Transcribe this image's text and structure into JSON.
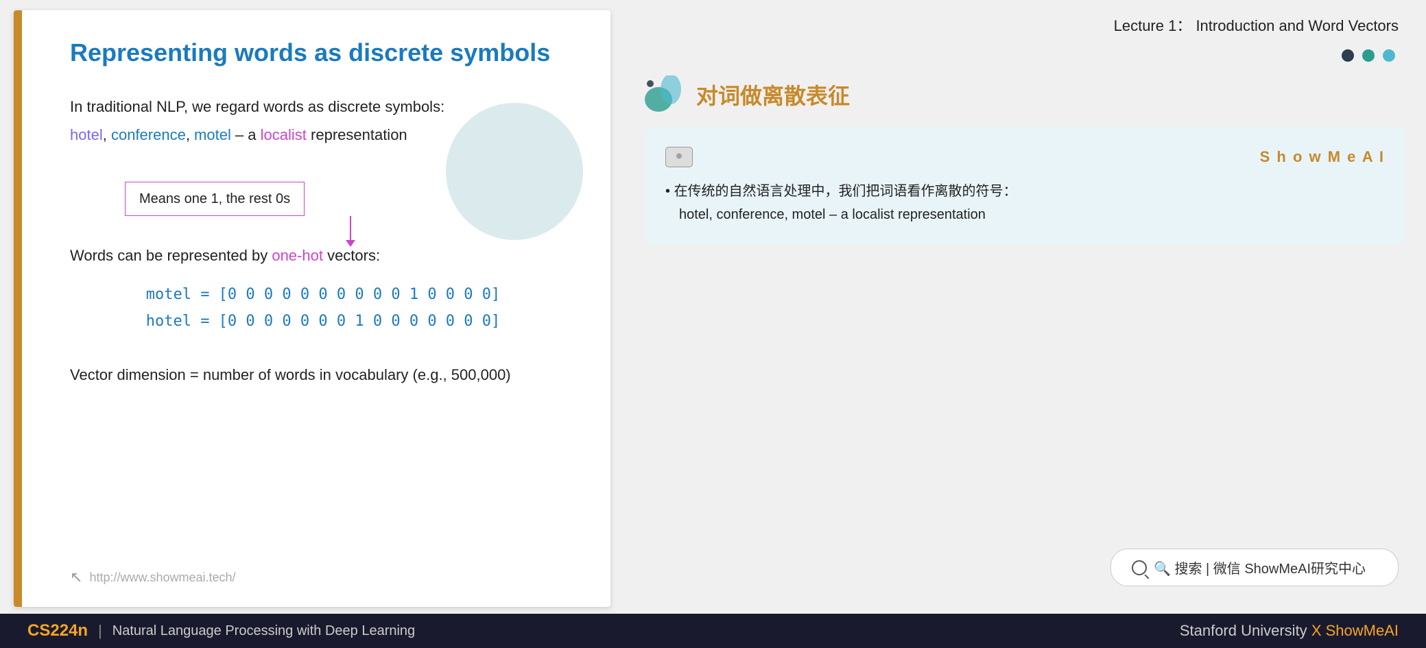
{
  "lecture": {
    "title": "Lecture 1： Introduction and Word Vectors"
  },
  "slide": {
    "title": "Representing words as discrete symbols",
    "paragraph1": "In traditional NLP, we regard words as discrete symbols:",
    "words_colored": "hotel, conference, motel",
    "rest_of_line": " – a ",
    "localist": "localist",
    "representation": " representation",
    "callout_text": "Means one 1, the rest 0s",
    "one_hot_intro": "Words can be represented by ",
    "one_hot": "one-hot",
    "one_hot_end": " vectors:",
    "vector1": "motel = [0 0 0 0 0 0 0 0 0 0 1 0 0 0 0]",
    "vector2": "hotel = [0 0 0 0 0 0 0 1 0 0 0 0 0 0 0]",
    "vocab_note": "Vector dimension = number of words in vocabulary (e.g., 500,000)",
    "footer_url": "http://www.showmeai.tech/"
  },
  "right_panel": {
    "chinese_title": "对词做离散表征",
    "dots": [
      "dark",
      "teal",
      "teal2"
    ],
    "annotation": {
      "showmeai_label": "S h o w M e A I",
      "bullet": "在传统的自然语言处理中，我们把词语看作离散的符号：",
      "sub_text": "hotel, conference, motel – a localist representation"
    }
  },
  "search_bar": {
    "text": "🔍 搜索 | 微信 ShowMeAI研究中心"
  },
  "bottom_bar": {
    "course": "CS224n",
    "divider": "|",
    "subtitle": "Natural Language Processing with Deep Learning",
    "right_text": "Stanford University",
    "x": "X",
    "showmeai": "ShowMeAI"
  }
}
